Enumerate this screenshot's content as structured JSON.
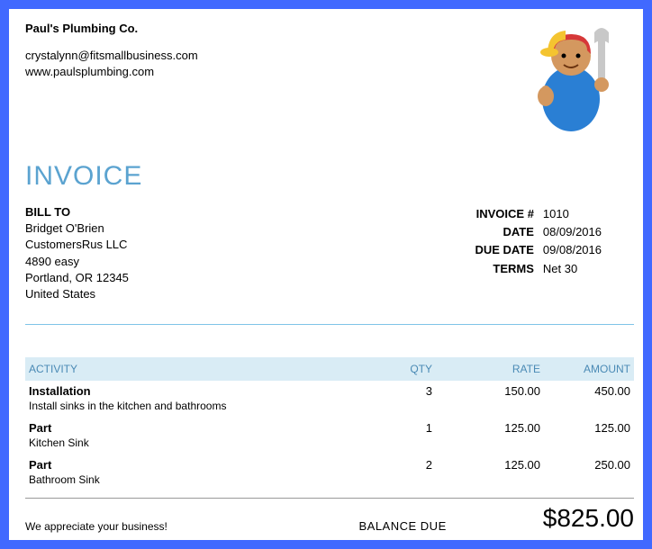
{
  "company": {
    "name": "Paul's Plumbing Co.",
    "email": "crystalynn@fitsmallbusiness.com",
    "website": "www.paulsplumbing.com"
  },
  "title": "INVOICE",
  "bill_to": {
    "label": "BILL TO",
    "name": "Bridget O'Brien",
    "org": "CustomersRus LLC",
    "street": "4890 easy",
    "city_line": "Portland, OR  12345",
    "country": "United States"
  },
  "meta": {
    "invoice_label": "INVOICE #",
    "invoice_number": "1010",
    "date_label": "DATE",
    "date": "08/09/2016",
    "due_label": "DUE DATE",
    "due_date": "09/08/2016",
    "terms_label": "TERMS",
    "terms": "Net 30"
  },
  "columns": {
    "activity": "ACTIVITY",
    "qty": "QTY",
    "rate": "RATE",
    "amount": "AMOUNT"
  },
  "items": [
    {
      "name": "Installation",
      "desc": "Install sinks in the kitchen and bathrooms",
      "qty": "3",
      "rate": "150.00",
      "amount": "450.00"
    },
    {
      "name": "Part",
      "desc": "Kitchen Sink",
      "qty": "1",
      "rate": "125.00",
      "amount": "125.00"
    },
    {
      "name": "Part",
      "desc": "Bathroom Sink",
      "qty": "2",
      "rate": "125.00",
      "amount": "250.00"
    }
  ],
  "footer": {
    "note": "We appreciate your business!",
    "balance_label": "BALANCE DUE",
    "balance": "$825.00"
  }
}
